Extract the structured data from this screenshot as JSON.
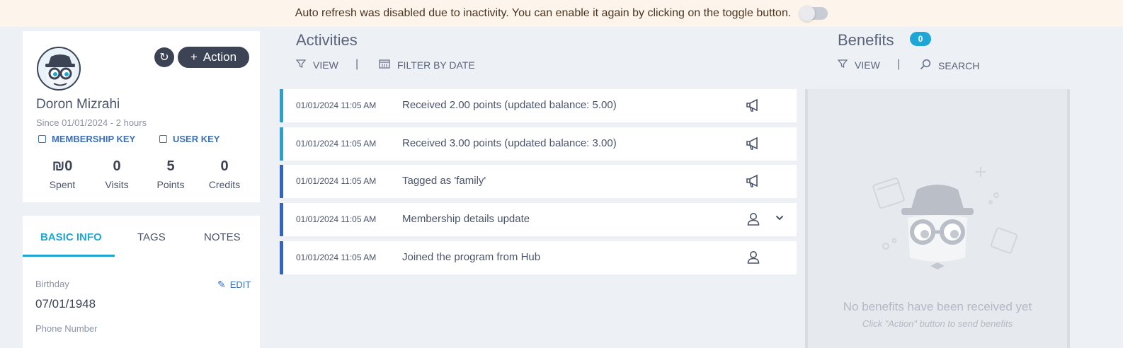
{
  "banner": {
    "message": "Auto refresh was disabled due to inactivity. You can enable it again by clicking on the toggle button."
  },
  "profile": {
    "action_label": "Action",
    "name": "Doron Mizrahi",
    "since": "Since 01/01/2024 - 2 hours",
    "membership_key_label": "MEMBERSHIP KEY",
    "user_key_label": "USER KEY",
    "stats": [
      {
        "value": "₪0",
        "label": "Spent"
      },
      {
        "value": "0",
        "label": "Visits"
      },
      {
        "value": "5",
        "label": "Points"
      },
      {
        "value": "0",
        "label": "Credits"
      }
    ]
  },
  "info": {
    "tabs": [
      "BASIC INFO",
      "TAGS",
      "NOTES"
    ],
    "edit_label": "EDIT",
    "birthday_label": "Birthday",
    "birthday_value": "07/01/1948",
    "phone_label": "Phone Number"
  },
  "activities": {
    "title": "Activities",
    "view_label": "VIEW",
    "filter_label": "FILTER BY DATE",
    "items": [
      {
        "date": "01/01/2024 11:05 AM",
        "text": "Received 2.00 points (updated balance: 5.00)",
        "icon": "megaphone-icon"
      },
      {
        "date": "01/01/2024 11:05 AM",
        "text": "Received 3.00 points (updated balance: 3.00)",
        "icon": "megaphone-icon"
      },
      {
        "date": "01/01/2024 11:05 AM",
        "text": "Tagged as 'family'",
        "icon": "megaphone-icon"
      },
      {
        "date": "01/01/2024 11:05 AM",
        "text": "Membership details update",
        "icon": "user-icon"
      },
      {
        "date": "01/01/2024 11:05 AM",
        "text": "Joined the program from Hub",
        "icon": "user-icon"
      }
    ]
  },
  "benefits": {
    "title": "Benefits",
    "count": "0",
    "view_label": "VIEW",
    "search_label": "SEARCH",
    "empty_title": "No benefits have been received yet",
    "empty_subtitle": "Click \"Action\" button to send benefits"
  },
  "colors": {
    "accent": "#1ea7d6",
    "dark_button": "#3b4354",
    "link": "#3d6fb5",
    "banner_bg": "#fdf5ec",
    "page_bg": "#edf0f4"
  }
}
